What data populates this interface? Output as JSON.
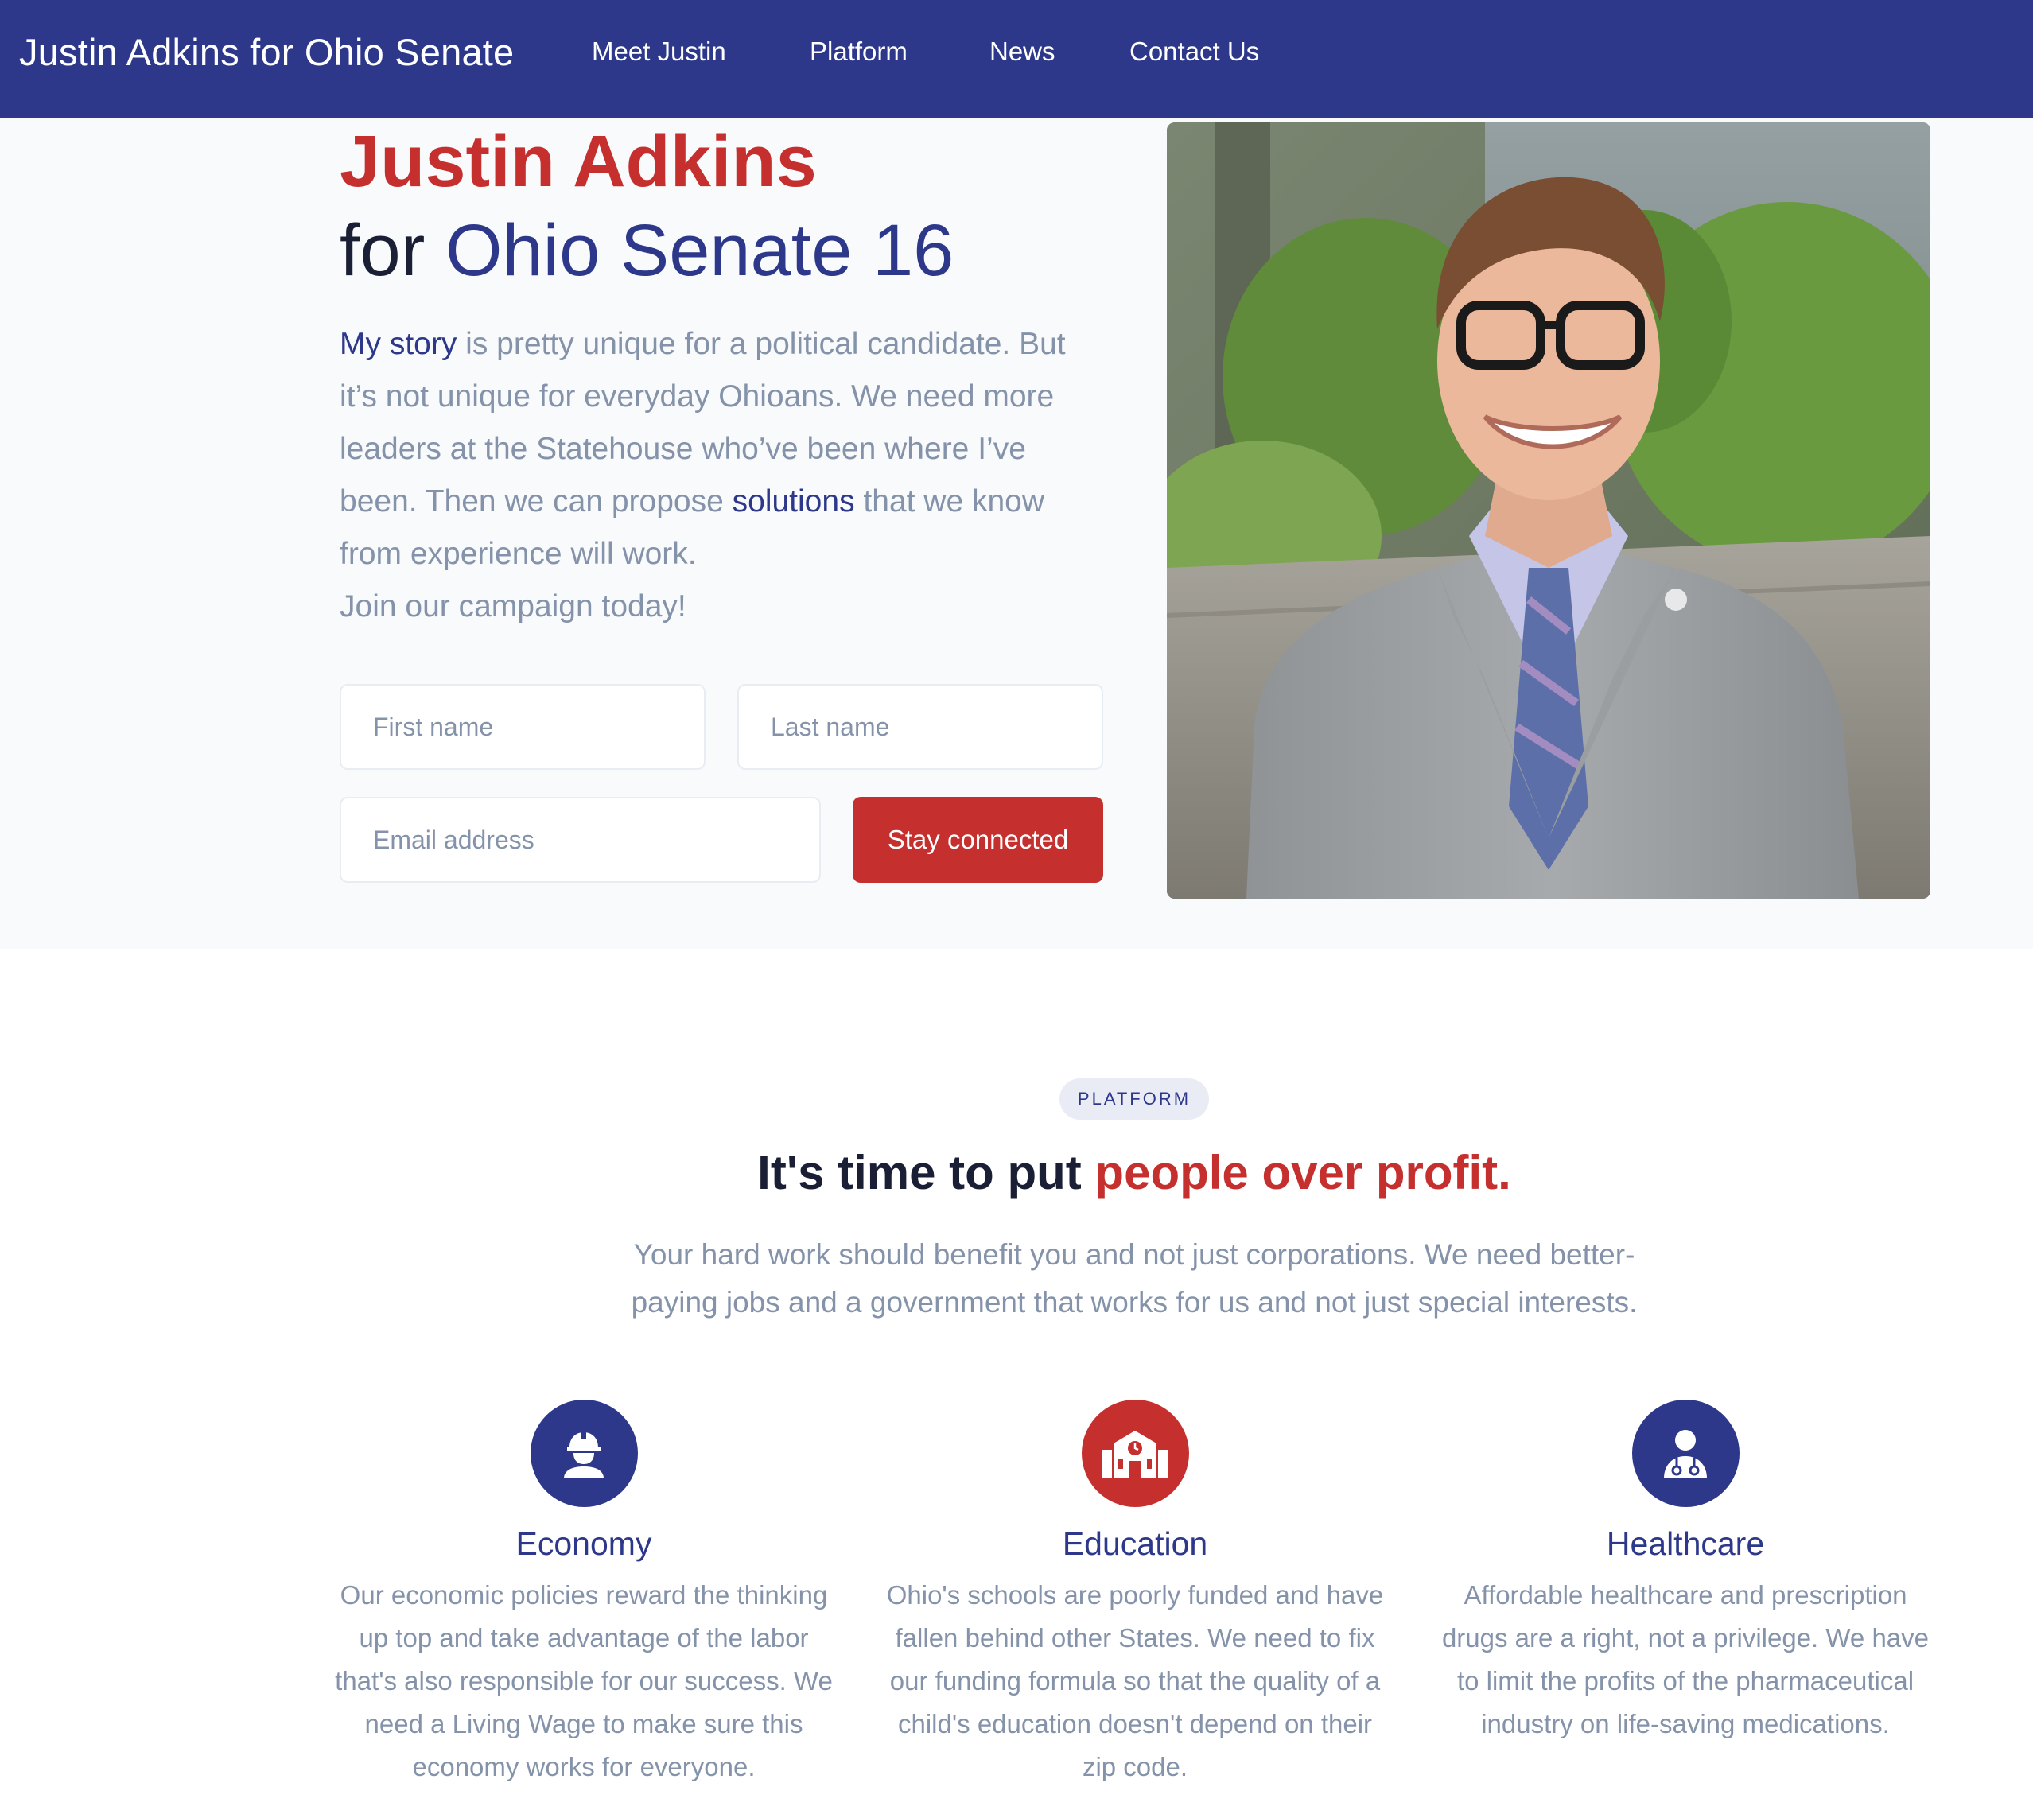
{
  "nav": {
    "brand": "Justin Adkins for Ohio Senate",
    "links": [
      "Meet Justin",
      "Platform",
      "News",
      "Contact Us"
    ]
  },
  "hero": {
    "title_line1": "Justin Adkins",
    "title_for": "for",
    "title_accent": "Ohio Senate 16",
    "text": {
      "link_story": "My story",
      "part1": " is pretty unique for a political candidate. But it’s not unique for everyday Ohioans. We need more leaders at the Statehouse who’ve been where I’ve been. Then we can propose ",
      "link_solutions": "solutions",
      "part2": " that we know from experience will work.",
      "cta": "Join our campaign today!"
    },
    "form": {
      "first_name_placeholder": "First name",
      "last_name_placeholder": "Last name",
      "email_placeholder": "Email address",
      "submit_label": "Stay connected"
    }
  },
  "platform": {
    "badge": "PLATFORM",
    "title_main": "It's time to put ",
    "title_accent": "people over profit.",
    "lead": "Your hard work should benefit you and not just corporations. We need better-paying jobs and a government that works for us and not just special interests.",
    "features": [
      {
        "icon": "worker-icon",
        "color": "#2d388a",
        "title": "Economy",
        "text": "Our economic policies reward the thinking up top and take advantage of the labor that's also responsible for our success. We need a Living Wage to make sure this economy works for everyone."
      },
      {
        "icon": "school-icon",
        "color": "#c5302f",
        "title": "Education",
        "text": "Ohio's schools are poorly funded and have fallen behind other States. We need to fix our funding formula so that the quality of a child's education doesn't depend on their zip code."
      },
      {
        "icon": "doctor-icon",
        "color": "#2d388a",
        "title": "Healthcare",
        "text": "Affordable healthcare and prescription drugs are a right, not a privilege. We have to limit the profits of the pharmaceutical industry on life-saving medications."
      }
    ]
  },
  "colors": {
    "navy": "#2d388a",
    "red": "#c5302f",
    "muted_text": "#8593aa",
    "hero_bg": "#f8fafc"
  }
}
